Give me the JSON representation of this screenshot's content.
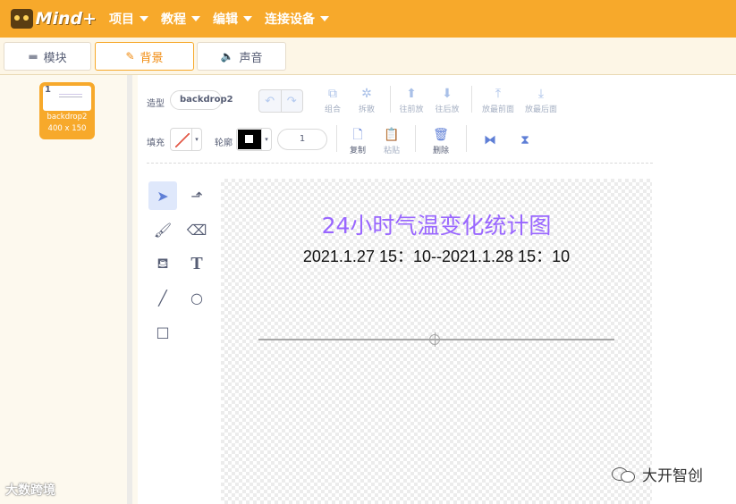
{
  "app": {
    "logo_text": "Mind+"
  },
  "menu": [
    {
      "label": "项目"
    },
    {
      "label": "教程"
    },
    {
      "label": "编辑"
    },
    {
      "label": "连接设备"
    }
  ],
  "tabs": [
    {
      "label": "模块",
      "icon": "blocks-icon",
      "active": false
    },
    {
      "label": "背景",
      "icon": "brush-icon",
      "active": true
    },
    {
      "label": "声音",
      "icon": "speaker-icon",
      "active": false
    }
  ],
  "costume": {
    "number": "1",
    "name": "backdrop2",
    "size": "400 x 150"
  },
  "toolbar": {
    "shape_label": "造型",
    "costume_name": "backdrop2",
    "group_label": "组合",
    "ungroup_label": "拆散",
    "forward_label": "往前放",
    "backward_label": "往后放",
    "front_label": "放最前面",
    "back_label": "放最后面",
    "fill_label": "填充",
    "outline_label": "轮廓",
    "outline_width": "1",
    "copy_label": "复制",
    "paste_label": "粘贴",
    "delete_label": "删除"
  },
  "canvas": {
    "title": "24小时气温变化统计图",
    "subtitle": "2021.1.27 15：10--2021.1.28 15：10",
    "title_color": "#9966ff"
  },
  "watermarks": {
    "left": "大数跨境",
    "right": "大开智创"
  },
  "colors": {
    "accent": "#f7a92b",
    "tool_blue": "#5f7fd6"
  }
}
